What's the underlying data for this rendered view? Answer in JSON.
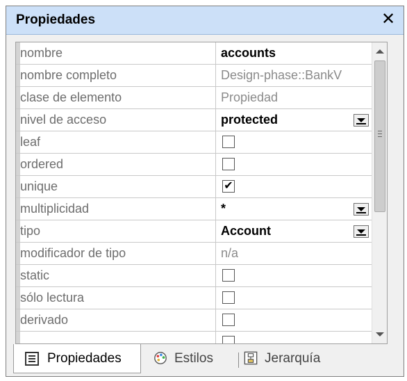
{
  "panel": {
    "title": "Propiedades",
    "close_glyph": "✕"
  },
  "properties": [
    {
      "name": "nombre",
      "value": "accounts",
      "kind": "text",
      "bold": true
    },
    {
      "name": "nombre completo",
      "value": "Design-phase::BankV",
      "kind": "text",
      "bold": false
    },
    {
      "name": "clase de elemento",
      "value": "Propiedad",
      "kind": "text",
      "bold": false
    },
    {
      "name": "nivel de acceso",
      "value": "protected",
      "kind": "dropdown",
      "bold": true
    },
    {
      "name": "leaf",
      "value": "",
      "kind": "checkbox",
      "checked": false
    },
    {
      "name": "ordered",
      "value": "",
      "kind": "checkbox",
      "checked": false
    },
    {
      "name": "unique",
      "value": "",
      "kind": "checkbox",
      "checked": true
    },
    {
      "name": "multiplicidad",
      "value": "*",
      "kind": "dropdown",
      "bold": true
    },
    {
      "name": "tipo",
      "value": "Account",
      "kind": "dropdown",
      "bold": true
    },
    {
      "name": "modificador de tipo",
      "value": "n/a",
      "kind": "text",
      "bold": false
    },
    {
      "name": "static",
      "value": "",
      "kind": "checkbox",
      "checked": false
    },
    {
      "name": "sólo lectura",
      "value": "",
      "kind": "checkbox",
      "checked": false
    },
    {
      "name": "derivado",
      "value": "",
      "kind": "checkbox",
      "checked": false
    },
    {
      "name": "",
      "value": "",
      "kind": "checkbox",
      "checked": false
    }
  ],
  "tabs": [
    {
      "label": "Propiedades",
      "icon": "properties-list-icon",
      "active": true
    },
    {
      "label": "Estilos",
      "icon": "palette-icon",
      "active": false
    },
    {
      "label": "Jerarquía",
      "icon": "hierarchy-icon",
      "active": false
    }
  ],
  "colors": {
    "titlebar": "#cce0f8",
    "name_text": "#6d6d6d",
    "readonly_value": "#8a8a8a"
  }
}
